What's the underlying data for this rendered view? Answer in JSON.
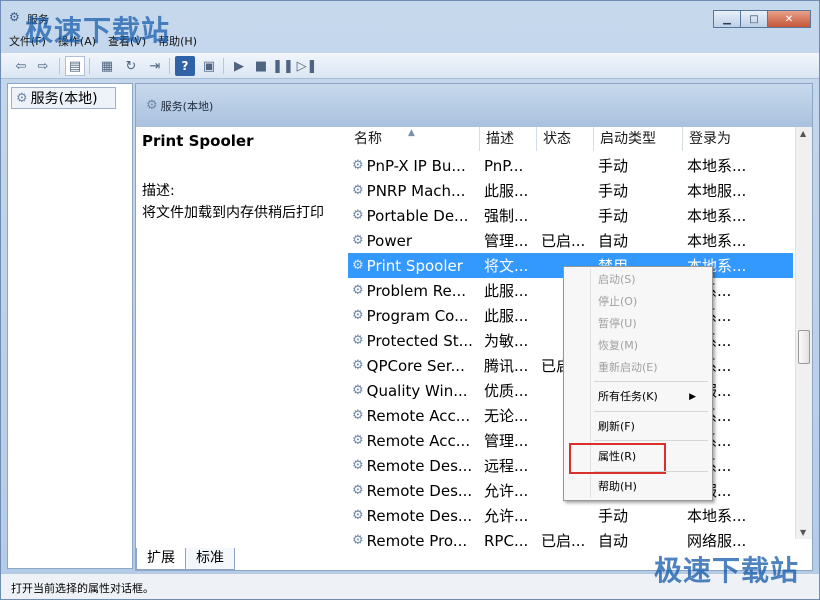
{
  "window": {
    "title": "服务"
  },
  "watermark": {
    "top_left": "极速下载站",
    "bottom_right": "极速下载站"
  },
  "menubar": {
    "items": [
      "文件(F)",
      "操作(A)",
      "查看(V)",
      "帮助(H)"
    ]
  },
  "toolbar": {
    "icons": [
      "back-arrow-icon",
      "forward-arrow-icon",
      "console-tree-icon",
      "properties-icon",
      "refresh-icon",
      "export-list-icon",
      "help-icon",
      "show-action-pane-icon",
      "start-service-icon",
      "stop-service-icon",
      "pause-service-icon",
      "restart-service-icon"
    ]
  },
  "tree": {
    "root_label": "服务(本地)"
  },
  "panel": {
    "header": "服务(本地)"
  },
  "details": {
    "title": "Print Spooler",
    "desc_label": "描述:",
    "desc_text": "将文件加载到内存供稍后打印"
  },
  "table": {
    "columns": [
      "名称",
      "描述",
      "状态",
      "启动类型",
      "登录为"
    ],
    "rows": [
      {
        "name": "PnP-X IP Bu...",
        "desc": "PnP...",
        "status": "",
        "startup": "手动",
        "logon": "本地系..."
      },
      {
        "name": "PNRP Mach...",
        "desc": "此服...",
        "status": "",
        "startup": "手动",
        "logon": "本地服..."
      },
      {
        "name": "Portable De...",
        "desc": "强制...",
        "status": "",
        "startup": "手动",
        "logon": "本地系..."
      },
      {
        "name": "Power",
        "desc": "管理...",
        "status": "已启...",
        "startup": "自动",
        "logon": "本地系..."
      },
      {
        "name": "Print Spooler",
        "desc": "将文...",
        "status": "",
        "startup": "禁用",
        "logon": "本地系...",
        "selected": true
      },
      {
        "name": "Problem Re...",
        "desc": "此服...",
        "status": "",
        "startup": "",
        "logon": "地系..."
      },
      {
        "name": "Program Co...",
        "desc": "此服...",
        "status": "",
        "startup": "",
        "logon": "地系..."
      },
      {
        "name": "Protected St...",
        "desc": "为敏...",
        "status": "",
        "startup": "",
        "logon": "地系..."
      },
      {
        "name": "QPCore Ser...",
        "desc": "腾讯...",
        "status": "已启",
        "startup": "",
        "logon": "地系..."
      },
      {
        "name": "Quality Win...",
        "desc": "优质...",
        "status": "",
        "startup": "",
        "logon": "地服..."
      },
      {
        "name": "Remote Acc...",
        "desc": "无论...",
        "status": "",
        "startup": "",
        "logon": "地系..."
      },
      {
        "name": "Remote Acc...",
        "desc": "管理...",
        "status": "",
        "startup": "",
        "logon": "地系..."
      },
      {
        "name": "Remote Des...",
        "desc": "远程...",
        "status": "",
        "startup": "",
        "logon": "地系..."
      },
      {
        "name": "Remote Des...",
        "desc": "允许...",
        "status": "",
        "startup": "",
        "logon": "地服..."
      },
      {
        "name": "Remote Des...",
        "desc": "允许...",
        "status": "",
        "startup": "手动",
        "logon": "本地系..."
      },
      {
        "name": "Remote Pro...",
        "desc": "RPC...",
        "status": "已启...",
        "startup": "自动",
        "logon": "网络服..."
      }
    ]
  },
  "tabs": [
    "扩展",
    "标准"
  ],
  "status_bar": "打开当前选择的属性对话框。",
  "context_menu": {
    "items": [
      {
        "label": "启动(S)",
        "disabled": true
      },
      {
        "label": "停止(O)",
        "disabled": true
      },
      {
        "label": "暂停(U)",
        "disabled": true
      },
      {
        "label": "恢复(M)",
        "disabled": true
      },
      {
        "label": "重新启动(E)",
        "disabled": true
      },
      {
        "label": "所有任务(K)",
        "disabled": false,
        "submenu": true
      },
      {
        "label": "刷新(F)",
        "disabled": false
      },
      {
        "label": "属性(R)",
        "disabled": false,
        "highlighted": true
      },
      {
        "label": "帮助(H)",
        "disabled": false
      }
    ]
  },
  "colors": {
    "selection": "#3399ff",
    "highlight_border": "#d9302b",
    "watermark": "#145aaa"
  }
}
